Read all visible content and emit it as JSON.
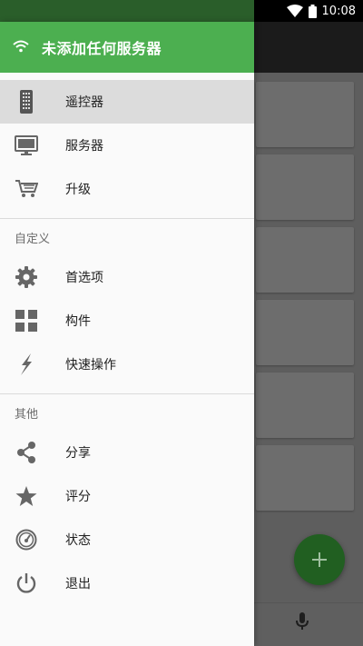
{
  "status_bar": {
    "time": "10:08"
  },
  "drawer": {
    "header_title": "未添加任何服务器",
    "items": [
      {
        "label": "遥控器",
        "icon": "remote-icon",
        "active": true
      },
      {
        "label": "服务器",
        "icon": "monitor-icon"
      },
      {
        "label": "升级",
        "icon": "cart-icon"
      }
    ],
    "customize": {
      "title": "自定义",
      "items": [
        {
          "label": "首选项",
          "icon": "gear-icon"
        },
        {
          "label": "构件",
          "icon": "widgets-icon"
        },
        {
          "label": "快速操作",
          "icon": "lightning-icon"
        }
      ]
    },
    "other": {
      "title": "其他",
      "items": [
        {
          "label": "分享",
          "icon": "share-icon"
        },
        {
          "label": "评分",
          "icon": "star-icon"
        },
        {
          "label": "状态",
          "icon": "gauge-icon"
        },
        {
          "label": "退出",
          "icon": "power-icon"
        }
      ]
    }
  },
  "colors": {
    "accent": "#4caf50",
    "fab": "#215f21"
  }
}
